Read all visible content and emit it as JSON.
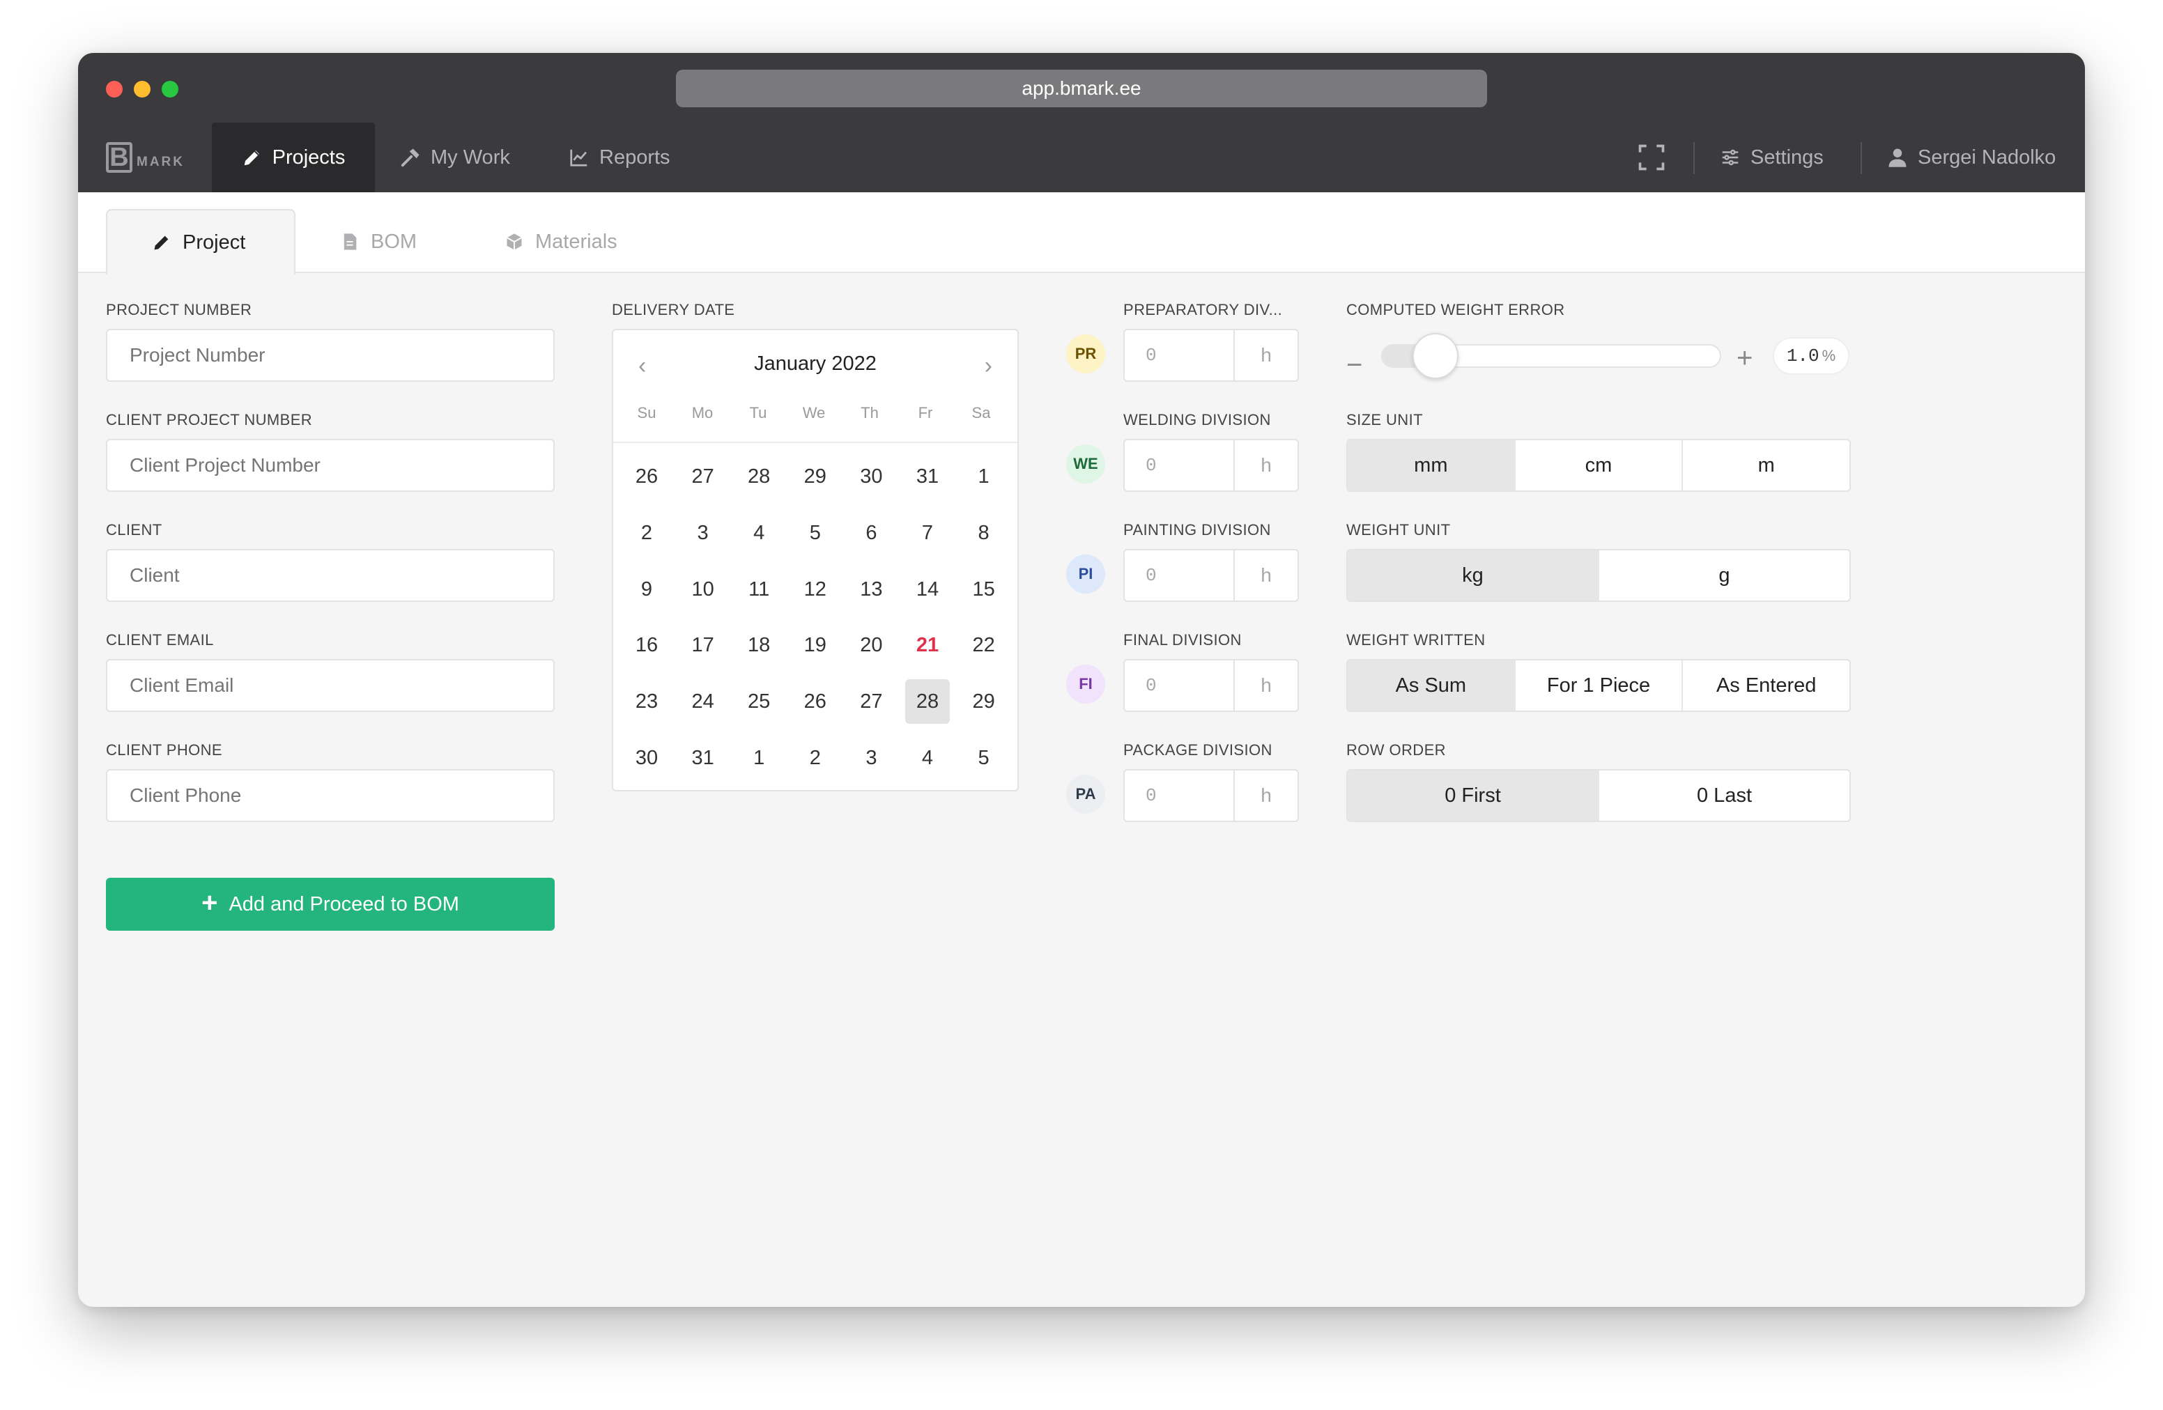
{
  "browser": {
    "url": "app.bmark.ee"
  },
  "app": {
    "logo_letter": "B",
    "logo_word": "MARK"
  },
  "nav": {
    "items": [
      {
        "label": "Projects"
      },
      {
        "label": "My Work"
      },
      {
        "label": "Reports"
      }
    ],
    "settings_label": "Settings",
    "user_name": "Sergei Nadolko"
  },
  "tabs": [
    {
      "label": "Project"
    },
    {
      "label": "BOM"
    },
    {
      "label": "Materials"
    }
  ],
  "form": {
    "project_number": {
      "label": "PROJECT NUMBER",
      "placeholder": "Project Number",
      "value": ""
    },
    "client_project_number": {
      "label": "CLIENT PROJECT NUMBER",
      "placeholder": "Client Project Number",
      "value": ""
    },
    "client": {
      "label": "CLIENT",
      "placeholder": "Client",
      "value": ""
    },
    "client_email": {
      "label": "CLIENT EMAIL",
      "placeholder": "Client Email",
      "value": ""
    },
    "client_phone": {
      "label": "CLIENT PHONE",
      "placeholder": "Client Phone",
      "value": ""
    },
    "submit_label": "Add and Proceed to BOM"
  },
  "delivery": {
    "label": "DELIVERY DATE",
    "month_label": "January 2022",
    "weekdays": [
      "Su",
      "Mo",
      "Tu",
      "We",
      "Th",
      "Fr",
      "Sa"
    ],
    "weeks": [
      [
        "26",
        "27",
        "28",
        "29",
        "30",
        "31",
        "1"
      ],
      [
        "2",
        "3",
        "4",
        "5",
        "6",
        "7",
        "8"
      ],
      [
        "9",
        "10",
        "11",
        "12",
        "13",
        "14",
        "15"
      ],
      [
        "16",
        "17",
        "18",
        "19",
        "20",
        "21",
        "22"
      ],
      [
        "23",
        "24",
        "25",
        "26",
        "27",
        "28",
        "29"
      ],
      [
        "30",
        "31",
        "1",
        "2",
        "3",
        "4",
        "5"
      ]
    ],
    "today": "21",
    "selected": "28"
  },
  "divisions": [
    {
      "label": "PREPARATORY DIV...",
      "badge": "PR",
      "value": "0",
      "unit": "h",
      "badge_bg": "#fdf3c4",
      "badge_fg": "#6b5200"
    },
    {
      "label": "WELDING DIVISION",
      "badge": "WE",
      "value": "0",
      "unit": "h",
      "badge_bg": "#dff5e6",
      "badge_fg": "#1d6b3a"
    },
    {
      "label": "PAINTING DIVISION",
      "badge": "PI",
      "value": "0",
      "unit": "h",
      "badge_bg": "#dde8fb",
      "badge_fg": "#2a4f9a"
    },
    {
      "label": "FINAL DIVISION",
      "badge": "FI",
      "value": "0",
      "unit": "h",
      "badge_bg": "#f1e3fb",
      "badge_fg": "#7a35a8"
    },
    {
      "label": "PACKAGE DIVISION",
      "badge": "PA",
      "value": "0",
      "unit": "h",
      "badge_bg": "#eceef2",
      "badge_fg": "#2f3a4a"
    }
  ],
  "weight_error": {
    "label": "COMPUTED WEIGHT ERROR",
    "value": "1.0",
    "unit": "%",
    "slider_fraction": 0.1
  },
  "size_unit": {
    "label": "SIZE UNIT",
    "options": [
      "mm",
      "cm",
      "m"
    ],
    "selected": "mm"
  },
  "weight_unit": {
    "label": "WEIGHT UNIT",
    "options": [
      "kg",
      "g"
    ],
    "selected": "kg"
  },
  "weight_written": {
    "label": "WEIGHT WRITTEN",
    "options": [
      "As Sum",
      "For 1 Piece",
      "As Entered"
    ],
    "selected": "As Sum"
  },
  "row_order": {
    "label": "ROW ORDER",
    "options": [
      "0 First",
      "0 Last"
    ],
    "selected": "0 First"
  },
  "colors": {
    "primary": "#24b47e",
    "today": "#e0314c",
    "chrome": "#3b3b3d"
  }
}
